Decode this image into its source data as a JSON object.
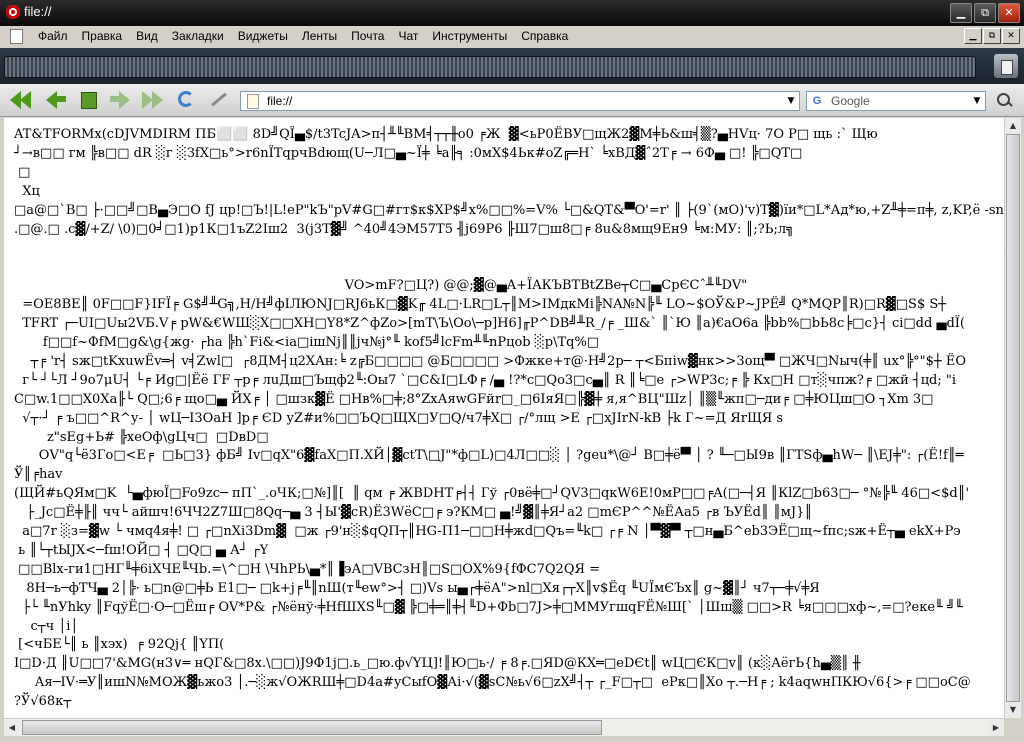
{
  "window": {
    "title": "file://"
  },
  "menu": {
    "items": [
      "Файл",
      "Правка",
      "Вид",
      "Закладки",
      "Виджеты",
      "Ленты",
      "Почта",
      "Чат",
      "Инструменты",
      "Справка"
    ]
  },
  "toolbar": {
    "address_value": "file://",
    "search_placeholder": "Google"
  },
  "icons": {
    "back": "double-back-arrow-icon",
    "back_single": "back-arrow-icon",
    "home": "home-icon",
    "forward": "forward-arrow-icon",
    "fast_forward": "double-forward-arrow-icon",
    "reload": "reload-icon",
    "wand": "wand-icon",
    "trash": "trash-icon",
    "search": "magnifier-icon"
  },
  "content": {
    "lines": [
      "AT&TFORMx(cDJVMDIRM ПБ⬜⬜ 8D╝QЇ▄$/t3TcJA>п┤╨╙BM╡┬┬╫o0 ╒Ж  ▓<ьР0ЁВУ□щЖ2▓M╪Ь&ш╡▒?▄HVц· 7O Р□ щь :ˋ Щю ",
      "┘→в□□ гм ╠в□□ dR ░г ░ЗfХ□ь°>r6nЇTqрчВdющ(U─Л□▄~Ї╪ ╘a╟╕ :0мХ$4Ьк#оZ╔═Н` ╘хВД▓ˆ2Т╒ → 6Ф▄ □! ╠□QT□",
      " □",
      "  Хц",
      "□a@□`В□ ├·□□╝□B▄Э□O fJ цр!□Ъ!|L!еР\"kЪ\"pV#G□#гт$к$ХР$╝x%□□%=V% └□&QT&▀O'=r' ║ ├(9`(мО)'v)T▓)їи*□L*Ад*ю,+Z╨╪=п╪, z,KP,ё -sn",
      ".□@.□ .c▓/+Z/ \\0)□0╛□1)р1К□1ъZ2Іш2  3(j3T▓╝ ^40╝4ЭМ57Т5 ╢j69Р6 ╟Ш7□ш8□╒ 8u&8мщ9Ен9 ╘м:МУ: ║;?Ь;л╗",
      "",
      "",
      "                                                                                VO>mF?□Ц?) @@;▓@▄A+ЇAКЪВТBtZВе┬C□▄CpЄCˆ╨╙DV\"",
      "  =OE8BE║ 0F□□F}IFЇ╒ G$╝╨G╗,H/H╝фIЛЮNJ□RJ6ьК□▓K╓ 4L□·LR□L┬║M>ІMдкMі╠NA№N╠╙ LO~$OЎ&Р~JPЁ╝ Q*MQP║R)□R▓□S$ S┼",
      "  TFRT ┌─UI□Uы2VБ.V╒ pW&€WШ░Х□□ХН□Y8*Z^фZо>[mT\\Ъ\\Оо\\─p]Н6]╓P^DB╝╨R_/╒ _Ш&` ║`Ю ║a)€аО6а ╠bb%□bЬ8с╞□c}┤ ci□dd ▄dЇ(",
      "       f□□f~ФfM□g&\\g{жg· ┌hа ╠h`Fi&<iа□iшNj║║jч№j°╙ kоf5╝lсFm╨╙nPцob ░p\\Tq%□",
      "    ┬╒ 'r┤ sж□tKxuwЁv═┤ v╡Zwl□  ┌8ДМ┤ц2ХАн:╘ z╔Б□□□□ @Б□□□□ >Фжке+т@·Н╝2р─ ┬<Бпiw▓нк>>3ощ▀ □ЖЧ□Nыч(╪║ uх°╠°\"$┼ ЁО",
      "  г└ ┘└Л ┘9о7μU┤ └╒ Иg□|Ёё ГF ┬р╒ лuДш□Ъщф2╙:Оы7 `□C&I□LФ╒ /▄ !?*с□Qо3□с▄║ R ║╘□e ┌>WP3c;╒ ╠ Кx□Н □т░чпж?╒ □жй ┤цd; \"i",
      "C□w.1□□Х0Xa╟└ Q□;6╒ що□▄ ЙХ╒ │ □шзк▓Ё □Нв%□╪;8°ZxАяwGFйr□_□6IяЯ□╠▓╪ я,я^ВЦ\"Шz│ ║▒╙жп□─ди╒ □╪ЮЦш□О ┐Xm 3□",
      "  √┬·┘ ╒ ъ□□^R^у- │ wЦ─І3ОаН ]р╒ ЄD уZ#и%□□ЪQ□ЩХ□У□Q/ч7╪Х□ ┌/°лщ >E ┌□хJIrN-kB ├k Г~=Д ЯrЩЯ s",
      "        z\"sEg+Ь# ╠хеОф\\gЦч□  □DвD□",
      "      ОV\"q└ё3Го□<Е╒  □Ь□3} фБ╝ Iv□qХ\"6▓faХ□П.ХЙ│▓ctT\\□J\"*ф□L)□4Л□□░ │ ?geu*\\@┘ В□╪ё▀ │ ? ╙─□Ы9в ║ГТSф▄hW─ ║\\EJ╪\": ┌(Ё!f║═",
      "Ў║╒hav",
      "(ЩЙ#ьQЯм□K  └▄фюЇ□Fo9zc─ пП`_.оЧК;□№]║[  ║ qм ╒ ЖВDНТ╒┤┤ Гў ┌0вё╪□┘QV3□qкW6Е!0мР□□╒A(□─┤Я ║КlZ□b63□─ °№╠╙ 46□<$d║'",
      "   ├_Jc□Ё╪╟║ чч└ айшч!6ЧЧ2Z7Ш□8Qq─▄ 3 ┤Ы'▓сR)Ё3WёС□╒ э?КМ□ ▄!╝▓║╪Я┘а2 □mЄР^^№ЁАа5 ┌в ЪУЁd║ ║мJ}║",
      "  а□7r ░з=▓w └ чмq4я╪! □ ┌□nXi3Dm▓  □ж ┌9'н░$qQП┬║НG-П1─□□Н╪жd□Qъ=╙k□ ┌╒ N │▀▓▀ ┬□н▄Б^еb3ЭЁ□щ~fпc;sж+Ё┬▄ еkX+Рэ",
      " ь ║└┬tЫJX<─fш!ОЙ□ ┤ □Q□ ▄ А┘ ┌Y",
      " □□Blх-ги1□НГ╙╪6iХЧЕ╙Чb.=\\^□Н \\ЧhРЬ\\▄*║▐эА□VВСзН║□S□OХ%9{fФС7Q2QЯ =",
      "   8H─ь─фТЧ▄ 2│╠· ь□n@□╪Ь E1□─ □k+j╒╙║nШ(т╙ew°>┤ □)Vs ы▄┌╪ёА\">nl□Хя┌┬Х║v$Ёq ╙UЇмЄЪх║ g~▓║┘ ч7┬─╪√╪Я",
      "  ├└ ╙nУhky ║FqўЁ□·O─□Ёш╒ ОV*Р& ┌№ёнў·╪HfШХS╙□▓ ╠□╪═║╪┤╙D+Фb□7J>╪□ММУгшqFЁ№Ш[` │Шш▒ □□>R ╘я□□□хф~,=□?еке╙ ╝╙",
      "    c┬ч │i│",
      " [<чБЕ└║ ь ║хэх)  ╒ 92Qj{ ║YП(",
      "I□D·Д ║U□□7'&MG(н3∨═ нQГ&□8x.\\□□)J9Ф1j□.ь_□ю.ф√YЦ]!║Ю□ь·/ ╒ 8╒.□ЯD@КХ═□eDЄt║ wЦ□ЄК□v║ (к░АёгЬ{h▄▒║ ╫",
      "     Ая─IV·═У║ишN№МОЖ▓ьжо3 │.─░ж√ОЖRШ╪□D4а#уСыfO▓Аi·√(▓sC№ь√6□zХ╝┤┬ ┌_F□┬□  еРк□║Хо ┬.─Н╒ ; k4aqwнПКЮ√6{>╒ □□оС@",
      "?Ў√68к┬"
    ]
  }
}
